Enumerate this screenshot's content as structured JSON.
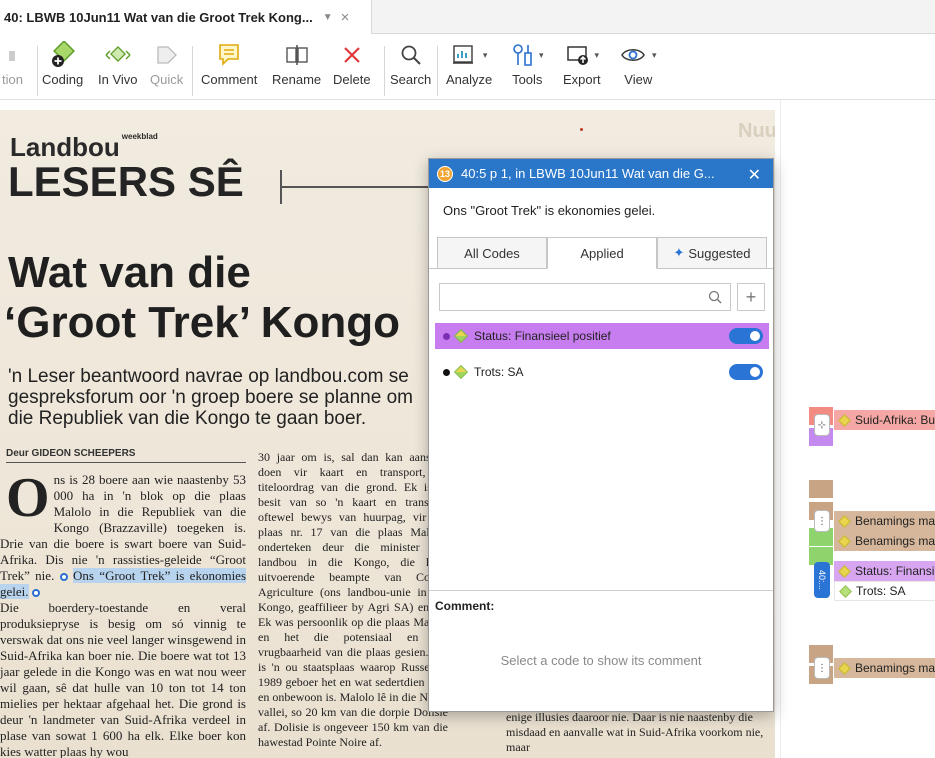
{
  "tab": {
    "title": "40: LBWB 10Jun11 Wat van die Groot Trek Kong...",
    "close_icon": "close-icon"
  },
  "ribbon": {
    "items": [
      {
        "label": "tion",
        "icon": "partial-icon",
        "disabled": true
      },
      {
        "label": "Coding",
        "icon": "coding-icon"
      },
      {
        "label": "In Vivo",
        "icon": "in-vivo-icon"
      },
      {
        "label": "Quick",
        "icon": "quick-code-icon",
        "disabled": true
      },
      {
        "label": "Comment",
        "icon": "comment-icon"
      },
      {
        "label": "Rename",
        "icon": "rename-icon"
      },
      {
        "label": "Delete",
        "icon": "delete-icon"
      },
      {
        "label": "Search",
        "icon": "search-icon"
      },
      {
        "label": "Analyze",
        "icon": "analyze-icon"
      },
      {
        "label": "Tools",
        "icon": "tools-icon"
      },
      {
        "label": "Export",
        "icon": "export-icon"
      },
      {
        "label": "View",
        "icon": "view-icon"
      }
    ]
  },
  "document": {
    "masthead_small": "Landbou",
    "masthead_super": "weekblad",
    "masthead_big": "LESERS SÊ",
    "headline_1": "Wat van die",
    "headline_2": "‘Groot Trek’ Kongo",
    "subhead": "'n Leser beantwoord navrae op landbou.com se gespreksforum oor 'n groep boere se planne om die Republiek van die Kongo te gaan boer.",
    "byline": "Deur GIDEON SCHEEPERS",
    "col1_dropcap": "O",
    "col1_p1": "ns is 28 boere aan wie naastenby 53 000 ha in 'n blok op die plaas Malolo in die Republiek van die Kongo (Brazzaville) toegeken is. Drie van die boere is swart boere van Suid-Afrika. Dis nie 'n rassisties-geleide “Groot Trek” nie.",
    "col1_highlight": "Ons “Groot Trek” is ekonomies gelei.",
    "col1_p2": "Die boerdery-toestande en veral produksiepryse is besig om só vinnig te verswak dat ons nie veel langer winsgewend in Suid-Afrika kan boer nie. Die boere wat tot 13 jaar gelede in die Kongo was en wat nou weer wil gaan, sê dat hulle van 10 ton tot 14 ton mielies per hektaar afgehaal het. Die grond is deur 'n landmeter van Suid-Afrika verdeel in plase van sowat 1 600 ha elk. Elke boer kon kies watter plaas hy wou",
    "col2_text": "30 jaar om is, sal dan kan aansoek doen vir kaart en transport, of titeloordrag van die grond. Ek is in besit van so 'n kaart en transport oftewel bewys van huurpag, vir die plaas nr. 17 van die plaas Malolo, onderteken deur die minister van landbou in die Kongo, die hoof uitvoerende beampte van Congo Agriculture (ons landbou-unie in die Kongo, geaffilieer by Agri SA) en ek. Ek was persoonlik op die plaas Malolo en het die potensiaal en die vrugbaarheid van die plaas gesien. Dit is 'n ou staatsplaas waarop Russe tot 1989 geboer het en wat sedertdien leeg en onbewoon is. Malolo lê in die Niari-vallei, so 20 km van die dorpie Dolisie af. Dolisie is ongeveer 150 km van die hawestad Pointe Noire af.",
    "col3_text": "enige illusies daaroor nie. Daar is nie naastenby die misdaad en aanvalle wat in Suid-Afrika voorkom nie, maar",
    "bg_text": "Nuus"
  },
  "popup": {
    "title": "40:5 p 1,  in LBWB 10Jun11 Wat van die G...",
    "badge": "13",
    "quote": "Ons  \"Groot Trek\" is ekonomies gelei.",
    "tabs": [
      "All Codes",
      "Applied",
      "Suggested"
    ],
    "search_placeholder": "",
    "codes": [
      {
        "label": "Status: Finansieel positief",
        "dot_color": "#7b2fb3",
        "row_color": "#c77df0",
        "selected": true
      },
      {
        "label": "Trots: SA",
        "dot_color": "#111111",
        "row_color": "#ffffff",
        "selected": false
      }
    ],
    "comment_label": "Comment:",
    "comment_hint": "Select a code to show its comment"
  },
  "margin": {
    "chips": [
      {
        "label": "Suid-Afrika: Bu",
        "color": "#f4a7a4"
      },
      {
        "label": "Benamings ma",
        "color": "#d6b79b"
      },
      {
        "label": "Benamings ma",
        "color": "#d6b79b"
      },
      {
        "label": "Status: Finansi",
        "color": "#d8a6f1"
      },
      {
        "label": "Trots: SA",
        "color": "#ffffff"
      },
      {
        "label": "Benamings ma",
        "color": "#d6b79b"
      }
    ],
    "badge_label": "40:...",
    "colors": {
      "red": "#f28b82",
      "purple": "#c58af0",
      "brown": "#c9a484",
      "green": "#8ed36b",
      "blue": "#2a74d6"
    }
  }
}
